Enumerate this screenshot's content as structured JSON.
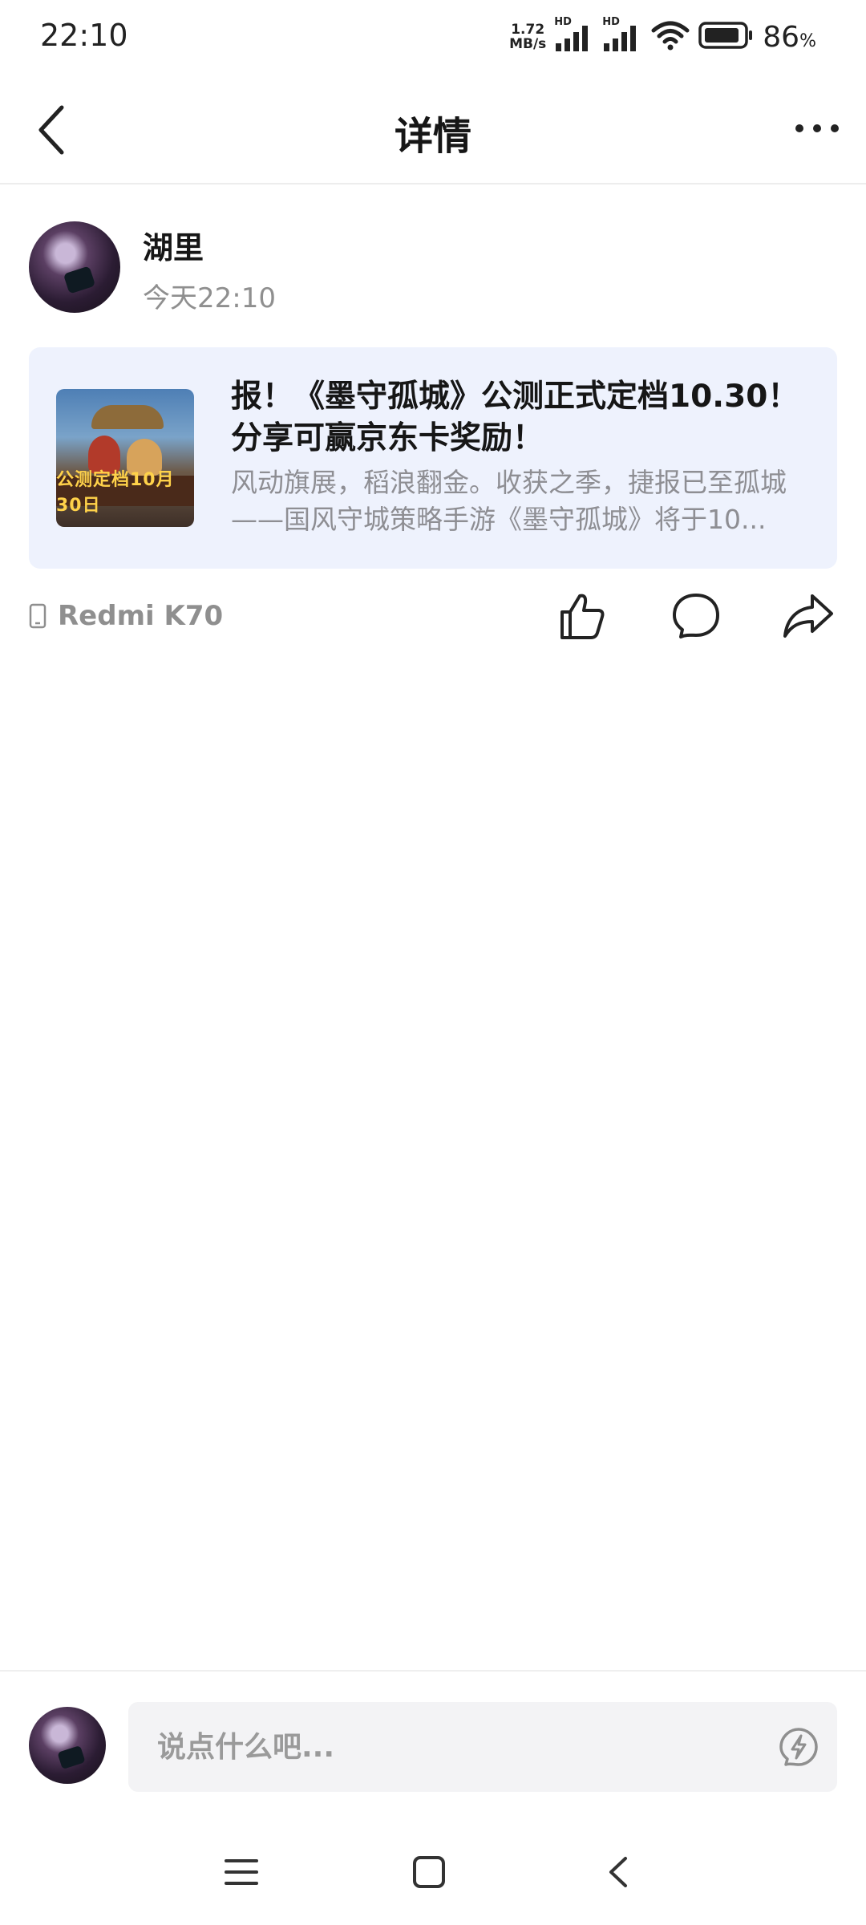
{
  "status_bar": {
    "time": "22:10",
    "net_speed_value": "1.72",
    "net_speed_unit": "MB/s",
    "hd_label": "HD",
    "battery_percent": "86",
    "battery_suffix": "%"
  },
  "header": {
    "title": "详情",
    "back_icon": "chevron-left-icon",
    "more_icon": "more-dots-icon"
  },
  "post": {
    "author_name": "湖里",
    "time": "今天22:10",
    "shared_card": {
      "title": "报！《墨守孤城》公测正式定档10.30！分享可赢京东卡奖励！",
      "description": "风动旗展，稻浪翻金。收获之季，捷报已至孤城——国风守城策略手游《墨守孤城》将于10...",
      "thumbnail_caption": "公测定档10月30日"
    },
    "device": "Redmi K70",
    "actions": [
      "like-icon",
      "comment-icon",
      "share-icon"
    ]
  },
  "comment_bar": {
    "placeholder": "说点什么吧...",
    "quick_icon": "lightning-icon"
  },
  "system_nav": [
    "menu-icon",
    "home-icon",
    "back-icon"
  ],
  "colors": {
    "card_background": "#eef2fd",
    "secondary_text": "#8f8f8f",
    "input_background": "#f3f3f5"
  }
}
